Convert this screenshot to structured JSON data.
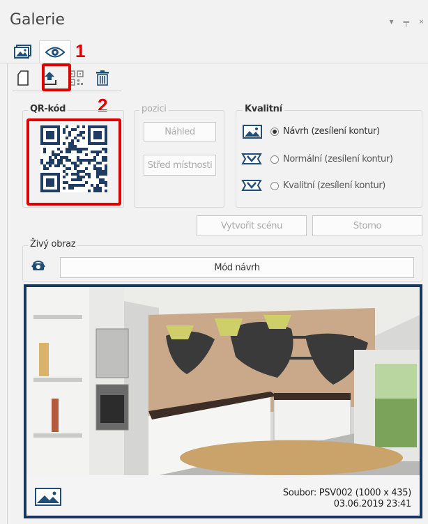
{
  "window": {
    "title": "Galerie",
    "controls": {
      "dropdown": "▾",
      "pin": "╤",
      "close": "×"
    }
  },
  "tabs": [
    {
      "icon": "gallery-image-icon"
    },
    {
      "icon": "eye-icon",
      "active": true
    }
  ],
  "annotations": {
    "one": "1",
    "two": "2"
  },
  "toolbar": [
    {
      "icon": "new-page-icon"
    },
    {
      "icon": "upload-icon",
      "highlighted": true
    },
    {
      "icon": "qr-icon"
    },
    {
      "icon": "trash-icon"
    }
  ],
  "qr_group": {
    "label": "QR-kód"
  },
  "position_group": {
    "label": "pozici",
    "preview_button": "Náhled",
    "center_button": "Střed místnosti"
  },
  "quality_group": {
    "label": "Kvalitní",
    "options": [
      {
        "label": "Návrh (zesílení kontur)",
        "checked": true,
        "icon": "draft-image-icon"
      },
      {
        "label": "Normální (zesílení kontur)",
        "checked": false,
        "icon": "normal-render-icon"
      },
      {
        "label": "Kvalitní (zesílení kontur)",
        "checked": false,
        "icon": "quality-render-icon"
      }
    ]
  },
  "actions": {
    "create_scene": "Vytvořit scénu",
    "cancel": "Storno"
  },
  "live_view": {
    "label": "Živý obraz",
    "mode_button": "Mód návrh"
  },
  "preview": {
    "file_line": "Soubor: PSV002 (1000 x 435)",
    "date_line": "03.06.2019 23:41"
  },
  "colors": {
    "highlight": "#e00000",
    "preview_border": "#17385c",
    "icon_blue": "#1f4e79"
  }
}
